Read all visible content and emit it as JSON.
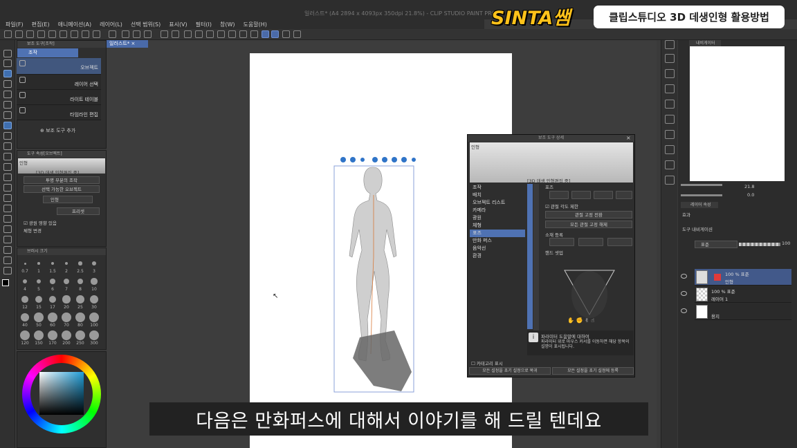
{
  "app": {
    "window_title": "일러스트* (A4 2894 x 4093px 350dpi 21.8%) - CLIP STUDIO PAINT PRO"
  },
  "menu": [
    "파일(F)",
    "편집(E)",
    "애니메이션(A)",
    "레이어(L)",
    "선택 범위(S)",
    "표시(V)",
    "필터(I)",
    "창(W)",
    "도움말(H)"
  ],
  "overlay": {
    "logo": "SINTA쌤",
    "badge": "클립스튜디오 3D 데생인형 활용방법",
    "subtitle": "다음은 만화퍼스에 대해서 이야기를 해 드릴 텐데요"
  },
  "subtool_panel": {
    "header": "보조 도구[조작]",
    "group": "조작",
    "items": [
      "오브젝트",
      "레이어 선택",
      "라이트 테이블",
      "타임라인 편집"
    ],
    "add_button": "보조 도구 추가"
  },
  "tool_property": {
    "header": "도구 속성[오브젝트]",
    "name": "인형",
    "mode": "[3D 데생 인형편집 중]",
    "transparent_label": "투명 부분의 조작",
    "selectable_label": "선택 가능한 오브젝트",
    "object_name": "인형",
    "preset_label": "프리셋",
    "light_label": "광원 영향 있음",
    "body_label": "체형 변경"
  },
  "brush_size": {
    "header": "브러시 크기",
    "sizes": [
      "0.7",
      "1",
      "1.5",
      "2",
      "2.5",
      "3",
      "4",
      "5",
      "6",
      "7",
      "8",
      "10",
      "12",
      "15",
      "17",
      "20",
      "25",
      "30",
      "40",
      "50",
      "60",
      "70",
      "80",
      "100",
      "120",
      "150",
      "170",
      "200",
      "250",
      "300"
    ]
  },
  "canvas_tab": {
    "label": "일러스트*",
    "zoom": "21.8"
  },
  "panel_3d": {
    "title": "보조 도구 상세",
    "header_name": "인형",
    "mode": "[3D 데생 인형편집 중]",
    "categories": [
      "조작",
      "배치",
      "오브젝트 리스트",
      "카메라",
      "광원",
      "체형",
      "포즈",
      "만화 퍼스",
      "음악선",
      "환경"
    ],
    "selected_category": "포즈",
    "section_pose": "포즈",
    "joint_limit": "관절 각도 제한",
    "fix_joint": "관절 고정 전환",
    "release_all": "모든 관절 고정 해제",
    "register": "소재 등록",
    "hand_setup": "핸드 셋업",
    "help_title": "파라미터 도움말에 대하여",
    "help_body": "파라미터 위로 마우스 커서를 이동하면 해당 항목의 설명이 표시됩니다.",
    "category_show": "카테고리 표시",
    "reset_btn": "모든 설정을 초기 설정으로 복귀",
    "register_btn": "모든 설정을 초기 설정에 등록"
  },
  "navigator": {
    "tab": "내비게이터"
  },
  "layer_panel": {
    "tab": "레이어 속성",
    "effect": "효과",
    "tool_label": "도구 내비게이션",
    "blend": "표준",
    "opacity": "100",
    "zoom_val": "21.8",
    "rot_val": "0.0",
    "layers": [
      {
        "opacity_mode": "100 % 표준",
        "name": "인형"
      },
      {
        "opacity_mode": "100 % 표준",
        "name": "레이어 1"
      },
      {
        "opacity_mode": "",
        "name": "용지"
      }
    ]
  },
  "colors": {
    "accent": "#4f72b3",
    "logo": "#ffc21a"
  }
}
